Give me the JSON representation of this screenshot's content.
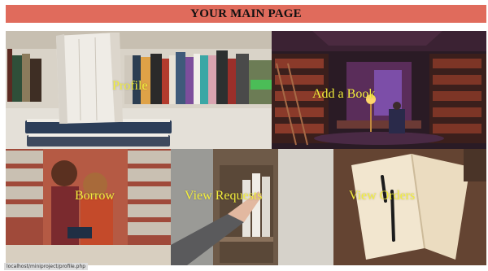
{
  "header": {
    "title": "YOUR MAIN PAGE",
    "background": "#e06b5c"
  },
  "tiles": [
    {
      "id": "profile",
      "label": "Profile",
      "image": "books-stack-shelf-photo"
    },
    {
      "id": "add-book",
      "label": "Add a Book",
      "image": "library-night-reading-photo"
    },
    {
      "id": "borrow",
      "label": "Borrow",
      "image": "girls-reading-library-photo"
    },
    {
      "id": "view-requests",
      "label": "View Requests",
      "image": "hand-reaching-bookshelf-photo"
    },
    {
      "id": "view-orders",
      "label": "View Orders",
      "image": "open-book-pens-photo"
    }
  ],
  "label_color": "#f3ef3c",
  "status_bar": {
    "text": "localhost/miniproject/profile.php"
  }
}
